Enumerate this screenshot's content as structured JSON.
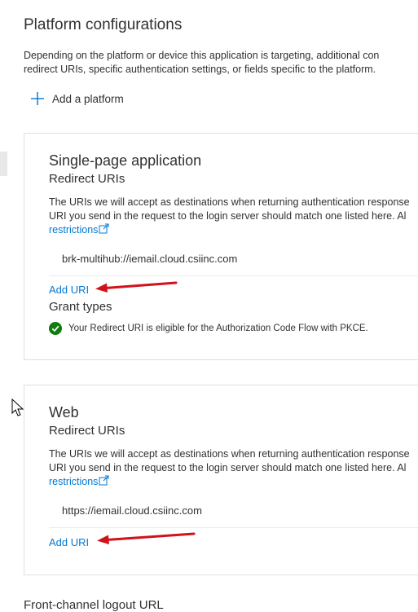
{
  "page": {
    "title": "Platform configurations",
    "description_line1": "Depending on the platform or device this application is targeting, additional con",
    "description_line2": "redirect URIs, specific authentication settings, or fields specific to the platform."
  },
  "add_platform": {
    "label": "Add a platform"
  },
  "spa": {
    "title": "Single-page application",
    "redirect_heading": "Redirect URIs",
    "desc_line1": "The URIs we will accept as destinations when returning authentication response",
    "desc_line2": "URI you send in the request to the login server should match one listed here. Al",
    "restrictions_link": "restrictions",
    "uri": "brk-multihub://iemail.cloud.csiinc.com",
    "add_uri": "Add URI",
    "grant_heading": "Grant types",
    "grant_message": "Your Redirect URI is eligible for the Authorization Code Flow with PKCE."
  },
  "web": {
    "title": "Web",
    "redirect_heading": "Redirect URIs",
    "desc_line1": "The URIs we will accept as destinations when returning authentication response",
    "desc_line2": "URI you send in the request to the login server should match one listed here. Al",
    "restrictions_link": "restrictions",
    "uri": "https://iemail.cloud.csiinc.com",
    "add_uri": "Add URI"
  },
  "partial_heading": "Front-channel logout URL",
  "colors": {
    "accent": "#0078d4",
    "arrow": "#d0121b",
    "success": "#107c10",
    "border": "#e1dfdd"
  },
  "icons": [
    "plus-icon",
    "external-link-icon",
    "success-check-icon",
    "annotation-arrow",
    "mouse-cursor-icon"
  ]
}
